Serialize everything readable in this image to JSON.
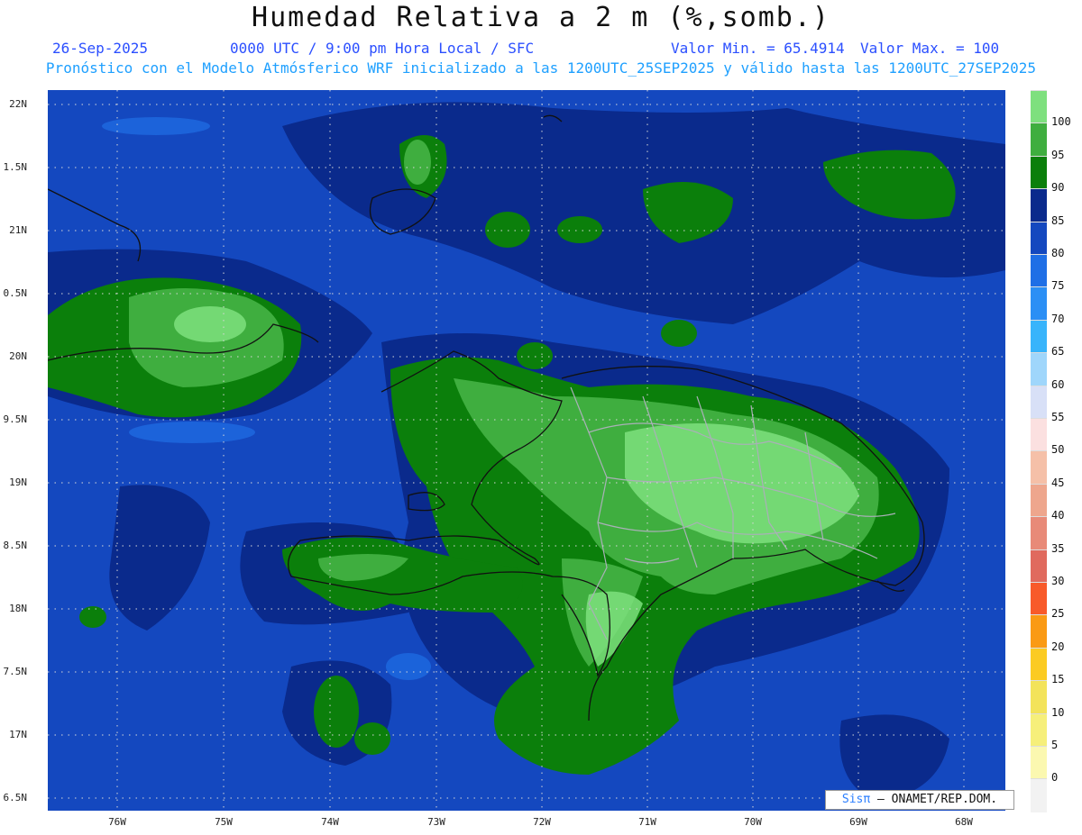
{
  "header": {
    "title": "Humedad Relativa a 2 m (%,somb.)",
    "date": "26-Sep-2025",
    "time": "0000 UTC / 9:00 pm Hora Local / SFC",
    "min_value": "Valor Min. = 65.4914",
    "max_value": "Valor Max. = 100",
    "subtitle": "Pronóstico con el Modelo Atmósferico WRF inicializado a las 1200UTC_25SEP2025 y válido hasta las  1200UTC_27SEP2025"
  },
  "axes": {
    "y_labels": [
      "22N",
      "1.5N",
      "21N",
      "0.5N",
      "20N",
      "9.5N",
      "19N",
      "8.5N",
      "18N",
      "7.5N",
      "17N",
      "6.5N"
    ],
    "x_labels": [
      "76W",
      "75W",
      "74W",
      "73W",
      "72W",
      "71W",
      "70W",
      "69W",
      "68W"
    ]
  },
  "colorbar": {
    "labels": [
      "100",
      "95",
      "90",
      "85",
      "80",
      "75",
      "70",
      "65",
      "60",
      "55",
      "50",
      "45",
      "40",
      "35",
      "30",
      "25",
      "20",
      "15",
      "10",
      "5",
      "0"
    ],
    "colors": [
      "#7ee07e",
      "#3fae3f",
      "#0b7f0b",
      "#0a2a8c",
      "#1448bf",
      "#1f6fe6",
      "#2b8ff5",
      "#38b4fb",
      "#9fd6fb",
      "#d8e0f7",
      "#fbe0e0",
      "#f5c0a8",
      "#eea68d",
      "#e88a78",
      "#e06a5e",
      "#f85a2a",
      "#fa9a14",
      "#fbcb22",
      "#f3e35a",
      "#f6ef7a",
      "#fbf8b0",
      "#f2f2f2"
    ]
  },
  "credit": {
    "brand": "Sisπ",
    "text": "– ONAMET/REP.DOM."
  }
}
